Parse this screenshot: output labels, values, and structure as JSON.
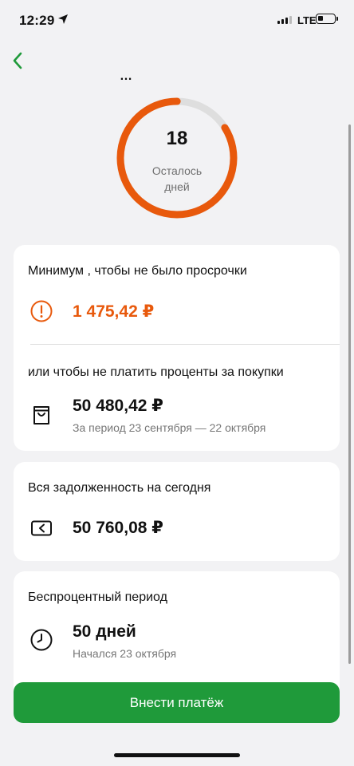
{
  "status_bar": {
    "time": "12:29",
    "network": "LTE",
    "battery_level": 0.25
  },
  "header": {
    "title": "…"
  },
  "countdown": {
    "days": "18",
    "label_line1": "Осталось",
    "label_line2": "дней",
    "remaining_fraction": 0.84,
    "ring_color": "#e8590c",
    "track_color": "#dedede"
  },
  "minimum_card": {
    "title": "Минимум , чтобы не было просрочки",
    "amount": "1 475,42 ₽",
    "amount_color": "#e8590c",
    "icon": "exclamation-circle-icon",
    "alt_title": "или чтобы не платить проценты за покупки",
    "alt_amount": "50 480,42 ₽",
    "alt_period": "За период 23 сентября — 22 октября",
    "alt_icon": "shopping-bag-icon"
  },
  "debt_card": {
    "title": "Вся задолженность на сегодня",
    "amount": "50 760,08 ₽",
    "icon": "card-arrow-icon"
  },
  "grace_card": {
    "title": "Беспроцентный период",
    "value": "50 дней",
    "started": "Начался 23 октября",
    "icon": "clock-icon"
  },
  "actions": {
    "pay_label": "Внести платёж",
    "pay_color": "#1f9a3a"
  }
}
